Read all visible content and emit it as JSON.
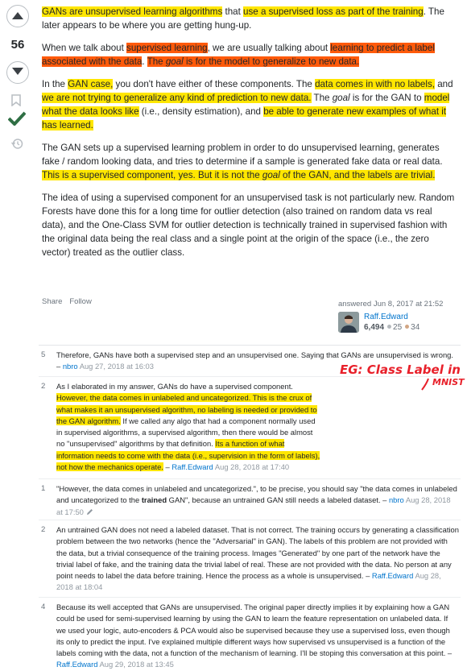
{
  "votes": {
    "count": "56"
  },
  "answer": {
    "p1": {
      "a": "GANs are unsupervised learning algorithms",
      "b": " that ",
      "c": "use a supervised loss as part of the training",
      "d": ". The later appears to be where you are getting hung-up."
    },
    "p2": {
      "a": "When we talk about ",
      "b": "supervised learning",
      "c": ", we are usually talking about ",
      "d": "learning to predict a label associated with the data",
      "e": ". ",
      "f": "The ",
      "g": "goal",
      "h": " is for the model to generalize to new data."
    },
    "p3": {
      "a": "In the ",
      "b": "GAN case,",
      "c": " you don't have either of these components. The ",
      "d": "data comes in with no labels,",
      "e": " and ",
      "f": "we are not trying to generalize any kind of prediction to new data.",
      "g": " The ",
      "h": "goal",
      "i": " is for the GAN to ",
      "j": "model what the data looks like",
      "k": " (i.e., density estimation), and ",
      "l": "be able to generate new examples of what it has learned."
    },
    "p4": {
      "a": "The GAN sets up a supervised learning problem in order to do unsupervised learning, generates fake / random looking data, and tries to determine if a sample is generated fake data or real data. ",
      "b": "This is a supervised component, yes. But it is not the ",
      "c": "goal",
      "d": " of the GAN, and the labels are trivial."
    },
    "p5": "The idea of using a supervised component for an unsupervised task is not particularly new. Random Forests have done this for a long time for outlier detection (also trained on random data vs real data), and the One-Class SVM for outlier detection is technically trained in supervised fashion with the original data being the real class and a single point at the origin of the space (i.e., the zero vector) treated as the outlier class."
  },
  "menu": {
    "share": "Share",
    "follow": "Follow"
  },
  "signature": {
    "answered": "answered Jun 8, 2017 at 21:52",
    "user": "Raff.Edward",
    "rep": "6,494",
    "silver": "25",
    "bronze": "34"
  },
  "comments": [
    {
      "score": "5",
      "text": "Therefore, GANs have both a supervised step and an unsupervised one. Saying that GANs are unsupervised is wrong. – ",
      "user": "nbro",
      "date": "Aug 27, 2018 at 16:03"
    },
    {
      "score": "2",
      "t1": "As I elaborated in my answer, GANs do have a supervised component. ",
      "t2": "However, the data comes in unlabeled and uncategorized. This is the crux of what makes it an unsupervised algorithm, no labeling is needed or provided to the GAN algorithm.",
      "t3": " If we called any algo that had a component normally used in supervised algorithms, a supervised algorithm, then there would be almost no \"unsupervised\" algorithms by that definition. ",
      "t4": "Its a function of what information needs to come with the data (i.e., supervision in the form of labels), not how the mechanics operate.",
      "t5": " – ",
      "user": "Raff.Edward",
      "date": "Aug 28, 2018 at 17:40"
    },
    {
      "score": "1",
      "t1": "\"However, the data comes in unlabeled and uncategorized.\", to be precise, you should say \"the data comes in unlabeled and uncategorized to the ",
      "t2": "trained",
      "t3": " GAN\", because an untrained GAN still needs a labeled dataset. – ",
      "user": "nbro",
      "date": "Aug 28, 2018 at 17:50"
    },
    {
      "score": "2",
      "text": "An untrained GAN does not need a labeled dataset. That is not correct. The training occurs by generating a classification problem between the two networks (hence the \"Adversarial\" in GAN). The labels of this problem are not provided with the data, but a trivial consequence of the training process. Images \"Generated\" by one part of the network have the trivial label of fake, and the training data the trivial label of real. These are not provided with the data. No person at any point needs to label the data before training. Hence the process as a whole is unsupervised. – ",
      "user": "Raff.Edward",
      "date": "Aug 28, 2018 at 18:04"
    },
    {
      "score": "4",
      "text": "Because its well accepted that GANs are unsupervised. The original paper directly implies it by explaining how a GAN could be used for semi-supervised learning by using the GAN to learn the feature representation on unlabeled data. If we used your logic, auto-encoders & PCA would also be supervised because they use a supervised loss, even though its only to predict the input. I've explained multiple different ways how supervised vs unsupervised is a function of the labels coming with the data, not a function of the mechanism of learning. I'll be stoping this conversation at this point. – ",
      "user": "Raff.Edward",
      "date": "Aug 29, 2018 at 13:45"
    }
  ],
  "annotation": {
    "line1": "EG: Class Label in",
    "line2": "MNIST"
  },
  "colors": {
    "highlight_yellow": "#ffe600",
    "highlight_orange": "#ff5a0a",
    "link": "#0074cc",
    "accept": "#2f6f44",
    "annotation_red": "#e8202a"
  }
}
